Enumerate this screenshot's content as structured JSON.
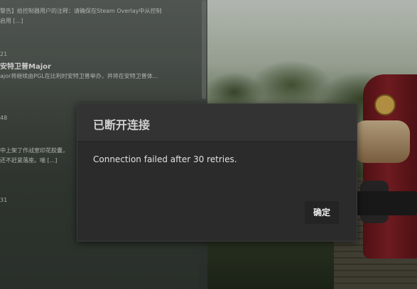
{
  "news_feed": {
    "items": [
      {
        "date": "",
        "title": "",
        "text_lines": [
          "警告】给控制器用户的注释：请确保在Steam Overlay中从控制",
          "启用 [...]"
        ]
      },
      {
        "date": "21",
        "title": "安特卫普Major",
        "text_lines": [
          "ajor将继续由PGL在比利时安特卫普举办，并将在安特卫普体..."
        ]
      },
      {
        "date": "48",
        "title": "",
        "text_lines": [
          "中上架了作战室印花胶囊，",
          "还不赶紧落座。喘 [...]"
        ]
      },
      {
        "date": "31",
        "title": "",
        "text_lines": []
      }
    ]
  },
  "dialog": {
    "title": "已断开连接",
    "message": "Connection failed after 30 retries.",
    "confirm_label": "确定"
  }
}
